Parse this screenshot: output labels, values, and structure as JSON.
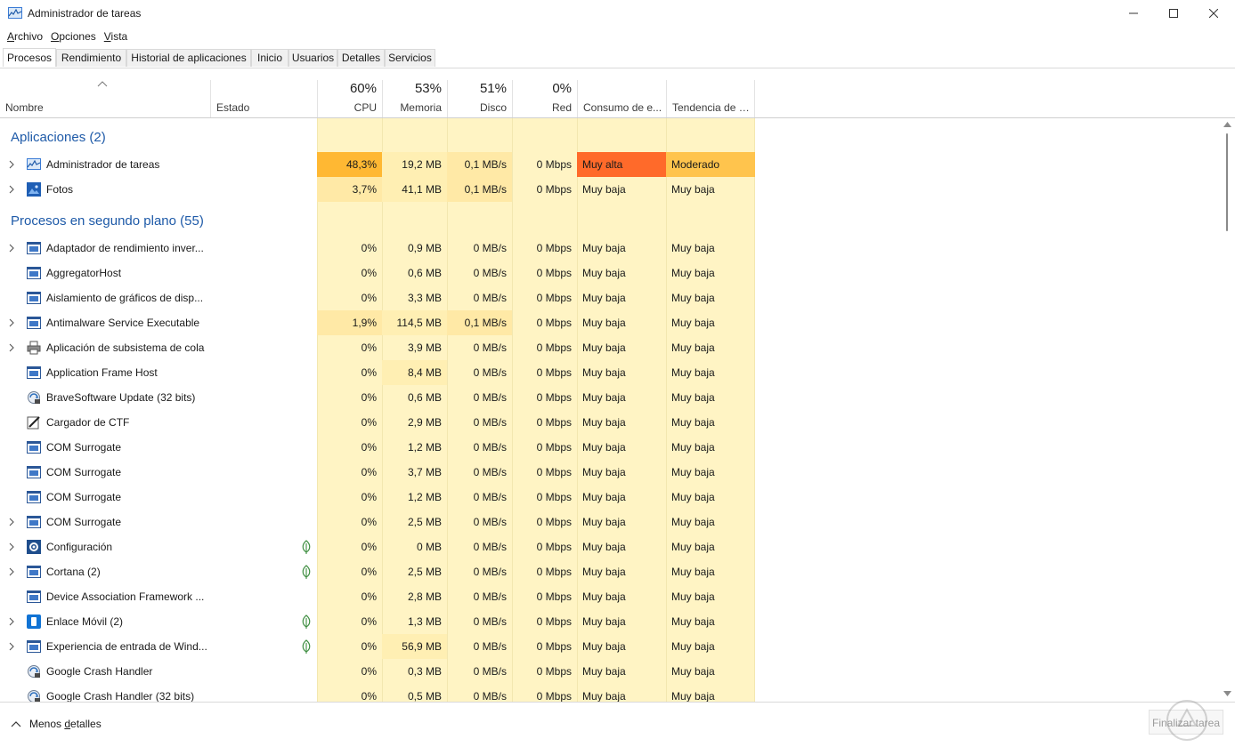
{
  "window": {
    "title": "Administrador de tareas"
  },
  "menu": [
    {
      "ul": "A",
      "rest": "rchivo"
    },
    {
      "ul": "O",
      "rest": "pciones"
    },
    {
      "ul": "V",
      "rest": "ista"
    }
  ],
  "tabs": [
    "Procesos",
    "Rendimiento",
    "Historial de aplicaciones",
    "Inicio",
    "Usuarios",
    "Detalles",
    "Servicios"
  ],
  "columns": {
    "name": "Nombre",
    "status": "Estado",
    "cpu": {
      "pct": "60%",
      "label": "CPU"
    },
    "mem": {
      "pct": "53%",
      "label": "Memoria"
    },
    "disk": {
      "pct": "51%",
      "label": "Disco"
    },
    "net": {
      "pct": "0%",
      "label": "Red"
    },
    "power": "Consumo de e...",
    "trend": "Tendencia de c..."
  },
  "groups": {
    "apps": "Aplicaciones (2)",
    "background": "Procesos en segundo plano (55)"
  },
  "apps": [
    {
      "name": "Administrador de tareas",
      "icon": "chart-icon",
      "cpu": "48,3%",
      "mem": "19,2 MB",
      "disk": "0,1 MB/s",
      "net": "0 Mbps",
      "power": "Muy alta",
      "trend": "Moderado"
    },
    {
      "name": "Fotos",
      "icon": "photos-icon",
      "cpu": "3,7%",
      "mem": "41,1 MB",
      "disk": "0,1 MB/s",
      "net": "0 Mbps",
      "power": "Muy baja",
      "trend": "Muy baja"
    }
  ],
  "processes": [
    {
      "name": "Adaptador de rendimiento inver...",
      "expand": true,
      "leaf": false,
      "icon": "window-icon",
      "cpu": "0%",
      "mem": "0,9 MB",
      "disk": "0 MB/s",
      "net": "0 Mbps",
      "power": "Muy baja",
      "trend": "Muy baja"
    },
    {
      "name": "AggregatorHost",
      "expand": false,
      "leaf": false,
      "icon": "window-icon",
      "cpu": "0%",
      "mem": "0,6 MB",
      "disk": "0 MB/s",
      "net": "0 Mbps",
      "power": "Muy baja",
      "trend": "Muy baja"
    },
    {
      "name": "Aislamiento de gráficos de disp...",
      "expand": false,
      "leaf": false,
      "icon": "window-icon",
      "cpu": "0%",
      "mem": "3,3 MB",
      "disk": "0 MB/s",
      "net": "0 Mbps",
      "power": "Muy baja",
      "trend": "Muy baja"
    },
    {
      "name": "Antimalware Service Executable",
      "expand": true,
      "leaf": false,
      "icon": "window-icon",
      "cpu": "1,9%",
      "mem": "114,5 MB",
      "disk": "0,1 MB/s",
      "net": "0 Mbps",
      "power": "Muy baja",
      "trend": "Muy baja"
    },
    {
      "name": "Aplicación de subsistema de cola",
      "expand": true,
      "leaf": false,
      "icon": "printer-icon",
      "cpu": "0%",
      "mem": "3,9 MB",
      "disk": "0 MB/s",
      "net": "0 Mbps",
      "power": "Muy baja",
      "trend": "Muy baja"
    },
    {
      "name": "Application Frame Host",
      "expand": false,
      "leaf": false,
      "icon": "window-icon",
      "cpu": "0%",
      "mem": "8,4 MB",
      "disk": "0 MB/s",
      "net": "0 Mbps",
      "power": "Muy baja",
      "trend": "Muy baja"
    },
    {
      "name": "BraveSoftware Update (32 bits)",
      "expand": false,
      "leaf": false,
      "icon": "update-icon",
      "cpu": "0%",
      "mem": "0,6 MB",
      "disk": "0 MB/s",
      "net": "0 Mbps",
      "power": "Muy baja",
      "trend": "Muy baja"
    },
    {
      "name": "Cargador de CTF",
      "expand": false,
      "leaf": false,
      "icon": "pen-icon",
      "cpu": "0%",
      "mem": "2,9 MB",
      "disk": "0 MB/s",
      "net": "0 Mbps",
      "power": "Muy baja",
      "trend": "Muy baja"
    },
    {
      "name": "COM Surrogate",
      "expand": false,
      "leaf": false,
      "icon": "window-icon",
      "cpu": "0%",
      "mem": "1,2 MB",
      "disk": "0 MB/s",
      "net": "0 Mbps",
      "power": "Muy baja",
      "trend": "Muy baja"
    },
    {
      "name": "COM Surrogate",
      "expand": false,
      "leaf": false,
      "icon": "window-icon",
      "cpu": "0%",
      "mem": "3,7 MB",
      "disk": "0 MB/s",
      "net": "0 Mbps",
      "power": "Muy baja",
      "trend": "Muy baja"
    },
    {
      "name": "COM Surrogate",
      "expand": false,
      "leaf": false,
      "icon": "window-icon",
      "cpu": "0%",
      "mem": "1,2 MB",
      "disk": "0 MB/s",
      "net": "0 Mbps",
      "power": "Muy baja",
      "trend": "Muy baja"
    },
    {
      "name": "COM Surrogate",
      "expand": true,
      "leaf": false,
      "icon": "window-icon",
      "cpu": "0%",
      "mem": "2,5 MB",
      "disk": "0 MB/s",
      "net": "0 Mbps",
      "power": "Muy baja",
      "trend": "Muy baja"
    },
    {
      "name": "Configuración",
      "expand": true,
      "leaf": true,
      "icon": "gear-icon",
      "cpu": "0%",
      "mem": "0 MB",
      "disk": "0 MB/s",
      "net": "0 Mbps",
      "power": "Muy baja",
      "trend": "Muy baja"
    },
    {
      "name": "Cortana (2)",
      "expand": true,
      "leaf": true,
      "icon": "window-icon",
      "cpu": "0%",
      "mem": "2,5 MB",
      "disk": "0 MB/s",
      "net": "0 Mbps",
      "power": "Muy baja",
      "trend": "Muy baja"
    },
    {
      "name": "Device Association Framework ...",
      "expand": false,
      "leaf": false,
      "icon": "window-icon",
      "cpu": "0%",
      "mem": "2,8 MB",
      "disk": "0 MB/s",
      "net": "0 Mbps",
      "power": "Muy baja",
      "trend": "Muy baja"
    },
    {
      "name": "Enlace Móvil (2)",
      "expand": true,
      "leaf": true,
      "icon": "phone-link-icon",
      "cpu": "0%",
      "mem": "1,3 MB",
      "disk": "0 MB/s",
      "net": "0 Mbps",
      "power": "Muy baja",
      "trend": "Muy baja"
    },
    {
      "name": "Experiencia de entrada de Wind...",
      "expand": true,
      "leaf": true,
      "icon": "window-icon",
      "cpu": "0%",
      "mem": "56,9 MB",
      "disk": "0 MB/s",
      "net": "0 Mbps",
      "power": "Muy baja",
      "trend": "Muy baja"
    },
    {
      "name": "Google Crash Handler",
      "expand": false,
      "leaf": false,
      "icon": "update-icon",
      "cpu": "0%",
      "mem": "0,3 MB",
      "disk": "0 MB/s",
      "net": "0 Mbps",
      "power": "Muy baja",
      "trend": "Muy baja"
    },
    {
      "name": "Google Crash Handler (32 bits)",
      "expand": false,
      "leaf": false,
      "icon": "update-icon",
      "cpu": "0%",
      "mem": "0,5 MB",
      "disk": "0 MB/s",
      "net": "0 Mbps",
      "power": "Muy baja",
      "trend": "Muy baja"
    }
  ],
  "footer": {
    "less_ul": "Menos ",
    "less_d": "d",
    "less_rest": "etalles",
    "end_task": "Finalizar tarea"
  },
  "colors": {
    "cell_bg": "#fff4c4",
    "cpu_hot": "#ffb833",
    "cpu_warm": "#ffe9a6",
    "power_very_high": "#ff6a2a",
    "trend_moderate": "#ffc44d",
    "group_title": "#1e5aa8"
  }
}
